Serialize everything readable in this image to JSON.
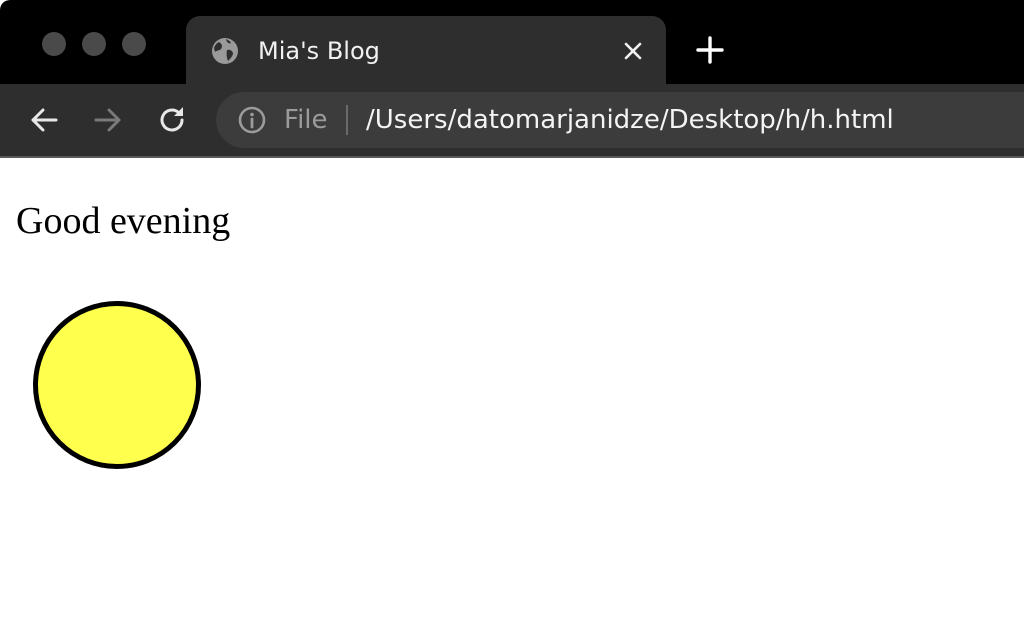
{
  "window": {
    "traffic_light_color": "#4a4a4a",
    "controls": [
      "close",
      "minimize",
      "zoom"
    ]
  },
  "tab": {
    "title": "Mia's Blog",
    "icon": "globe-icon",
    "close_icon": "close-icon"
  },
  "new_tab": {
    "icon": "plus-icon"
  },
  "toolbar": {
    "back_icon": "arrow-left-icon",
    "forward_icon": "arrow-right-icon",
    "reload_icon": "reload-icon"
  },
  "omnibox": {
    "info_icon": "info-icon",
    "scheme_label": "File",
    "url": "/Users/datomarjanidze/Desktop/h/h.html"
  },
  "page": {
    "greeting": "Good evening",
    "circle": {
      "fill_color": "#ffff4d",
      "border_color": "#000000"
    }
  },
  "colors": {
    "tabstrip_bg": "#000000",
    "active_tab_bg": "#2e2e2f",
    "omnibox_bg": "#3c3c3d",
    "page_bg": "#ffffff"
  }
}
